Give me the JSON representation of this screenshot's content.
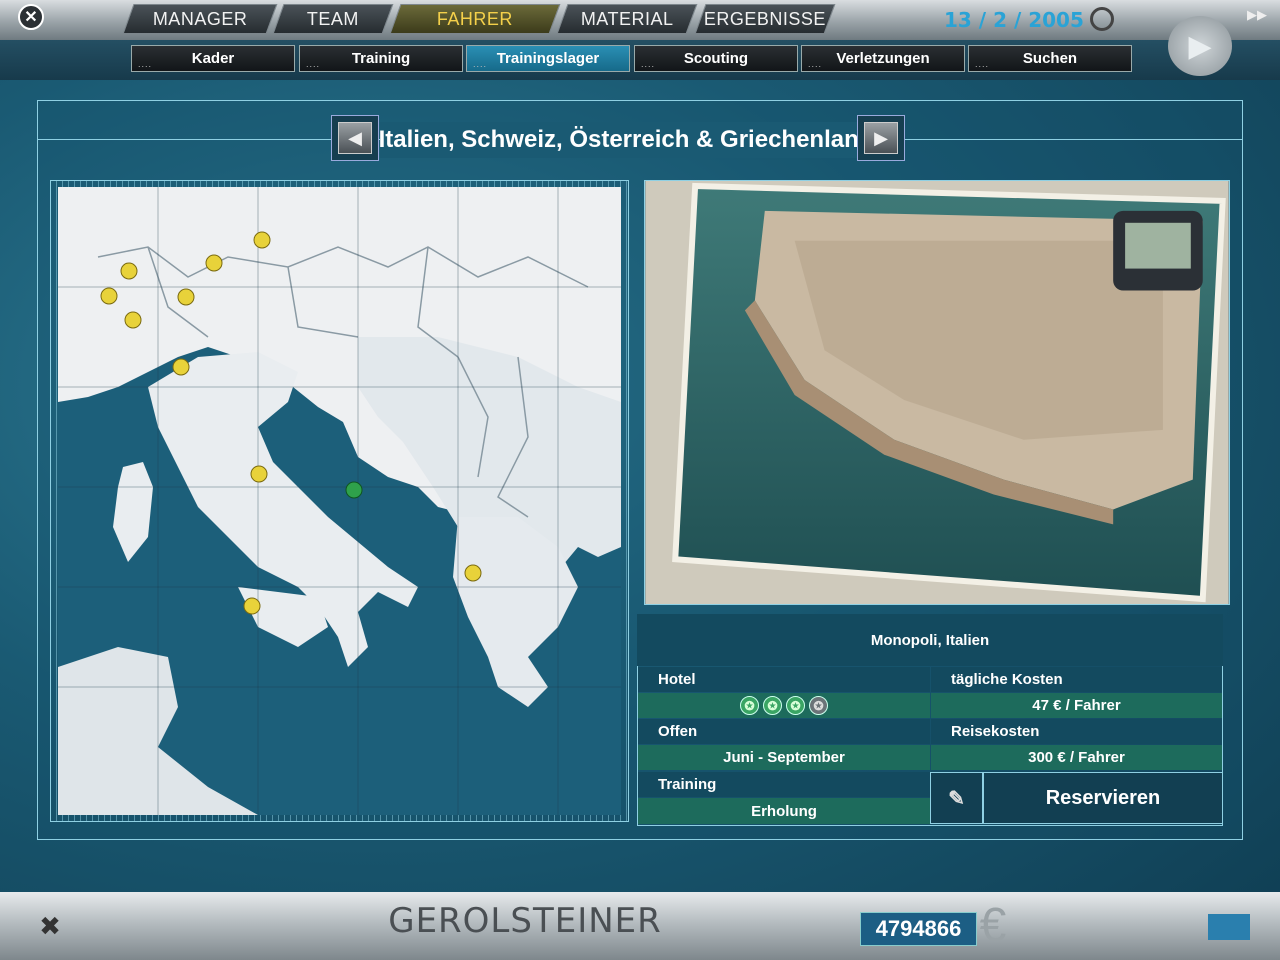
{
  "nav": {
    "tabs": [
      {
        "label": "MANAGER"
      },
      {
        "label": "TEAM"
      },
      {
        "label": "FAHRER",
        "active": true
      },
      {
        "label": "MATERIAL"
      },
      {
        "label": "ERGEBNISSE"
      }
    ],
    "subtabs": [
      {
        "label": "Kader"
      },
      {
        "label": "Training"
      },
      {
        "label": "Trainingslager",
        "active": true
      },
      {
        "label": "Scouting"
      },
      {
        "label": "Verletzungen"
      },
      {
        "label": "Suchen"
      }
    ],
    "subtab_dots": "....",
    "date": "13 / 2 / 2005",
    "forward_icon": "play-icon",
    "fast_forward_icon": "fast-forward-icon",
    "close_icon": "close-icon"
  },
  "region": {
    "title": "Italien, Schweiz, Österreich & Griechenland",
    "prev_icon": "arrow-left-icon",
    "next_icon": "arrow-right-icon"
  },
  "map": {
    "pins_total": 11,
    "selected_pin": "Monopoli, Italien",
    "pin_color": "#e8d23a",
    "selected_pin_color": "#2fa14b"
  },
  "details": {
    "location": "Monopoli, Italien",
    "hotel_label": "Hotel",
    "hotel_rating": 3,
    "hotel_rating_max": 4,
    "daily_cost_label": "tägliche Kosten",
    "daily_cost_value": "47 € / Fahrer",
    "open_label": "Offen",
    "open_value": "Juni - September",
    "travel_cost_label": "Reisekosten",
    "travel_cost_value": "300 € / Fahrer",
    "training_label": "Training",
    "training_value": "Erholung",
    "reserve_label": "Reservieren",
    "edit_icon": "pencil-icon"
  },
  "footer": {
    "team_name": "GEROLSTEINER",
    "money": "4794866",
    "currency_symbol": "€",
    "tools_icon": "tools-icon"
  },
  "colors": {
    "accent": "#2aa3d6",
    "panel_border": "#8fd0e3",
    "active_tab_text": "#f4d04a",
    "value_row": "#1d6b5c"
  }
}
